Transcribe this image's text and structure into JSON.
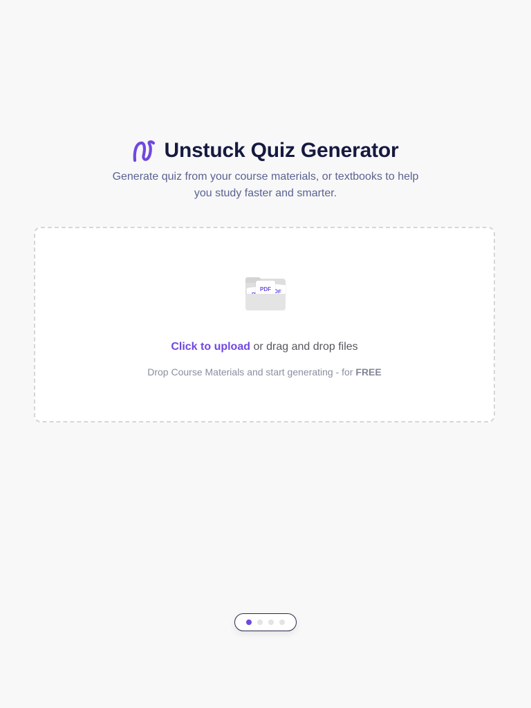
{
  "app": {
    "title": "Unstuck Quiz Generator",
    "subtitle": "Generate quiz from your course materials, or textbooks to help you study faster and smarter."
  },
  "upload": {
    "icon": "pdf-folder-icon",
    "pdf_labels": [
      "PDF",
      "PDF",
      "PDF"
    ],
    "link_label": "Click to upload",
    "rest_label": " or drag and drop files",
    "hint_prefix": "Drop Course Materials and start generating - for ",
    "hint_emphasis": "FREE"
  },
  "pager": {
    "count": 4,
    "active_index": 0
  },
  "colors": {
    "brand": "#7048e0",
    "title": "#161a3f",
    "subtitle": "#5a6292",
    "background": "#f8f8f8"
  }
}
